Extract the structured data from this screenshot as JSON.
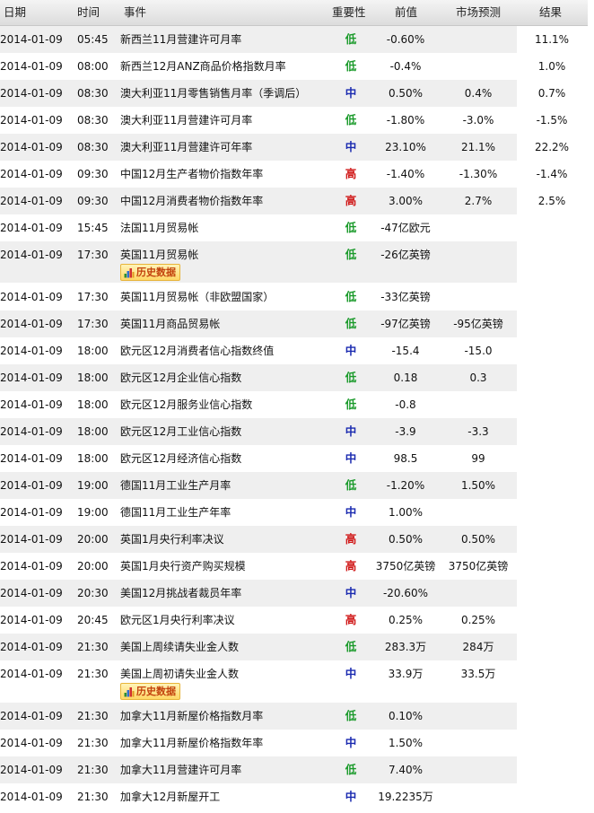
{
  "headers": {
    "date": "日期",
    "time": "时间",
    "event": "事件",
    "importance": "重要性",
    "previous": "前值",
    "forecast": "市场预测",
    "actual": "结果"
  },
  "history_button_label": "历史数据",
  "colors": {
    "low": "#1a9a2a",
    "medium": "#1a2ab0",
    "high": "#d01818",
    "row_alt": "#efefef"
  },
  "rows": [
    {
      "date": "2014-01-09",
      "time": "05:45",
      "event": "新西兰11月营建许可月率",
      "importance": "低",
      "previous": "-0.60%",
      "forecast": "",
      "actual": "11.1%"
    },
    {
      "date": "2014-01-09",
      "time": "08:00",
      "event": "新西兰12月ANZ商品价格指数月率",
      "importance": "低",
      "previous": "-0.4%",
      "forecast": "",
      "actual": "1.0%"
    },
    {
      "date": "2014-01-09",
      "time": "08:30",
      "event": "澳大利亚11月零售销售月率（季调后）",
      "importance": "中",
      "previous": "0.50%",
      "forecast": "0.4%",
      "actual": "0.7%"
    },
    {
      "date": "2014-01-09",
      "time": "08:30",
      "event": "澳大利亚11月营建许可月率",
      "importance": "低",
      "previous": "-1.80%",
      "forecast": "-3.0%",
      "actual": "-1.5%"
    },
    {
      "date": "2014-01-09",
      "time": "08:30",
      "event": "澳大利亚11月营建许可年率",
      "importance": "中",
      "previous": "23.10%",
      "forecast": "21.1%",
      "actual": "22.2%"
    },
    {
      "date": "2014-01-09",
      "time": "09:30",
      "event": "中国12月生产者物价指数年率",
      "importance": "高",
      "previous": "-1.40%",
      "forecast": "-1.30%",
      "actual": "-1.4%"
    },
    {
      "date": "2014-01-09",
      "time": "09:30",
      "event": "中国12月消费者物价指数年率",
      "importance": "高",
      "previous": "3.00%",
      "forecast": "2.7%",
      "actual": "2.5%"
    },
    {
      "date": "2014-01-09",
      "time": "15:45",
      "event": "法国11月贸易帐",
      "importance": "低",
      "previous": "-47亿欧元",
      "forecast": "",
      "actual": ""
    },
    {
      "date": "2014-01-09",
      "time": "17:30",
      "event": "英国11月贸易帐",
      "importance": "低",
      "previous": "-26亿英镑",
      "forecast": "",
      "actual": "",
      "history": true
    },
    {
      "date": "2014-01-09",
      "time": "17:30",
      "event": "英国11月贸易帐（非欧盟国家）",
      "importance": "低",
      "previous": "-33亿英镑",
      "forecast": "",
      "actual": ""
    },
    {
      "date": "2014-01-09",
      "time": "17:30",
      "event": "英国11月商品贸易帐",
      "importance": "低",
      "previous": "-97亿英镑",
      "forecast": "-95亿英镑",
      "actual": ""
    },
    {
      "date": "2014-01-09",
      "time": "18:00",
      "event": "欧元区12月消费者信心指数终值",
      "importance": "中",
      "previous": "-15.4",
      "forecast": "-15.0",
      "actual": ""
    },
    {
      "date": "2014-01-09",
      "time": "18:00",
      "event": "欧元区12月企业信心指数",
      "importance": "低",
      "previous": "0.18",
      "forecast": "0.3",
      "actual": ""
    },
    {
      "date": "2014-01-09",
      "time": "18:00",
      "event": "欧元区12月服务业信心指数",
      "importance": "低",
      "previous": "-0.8",
      "forecast": "",
      "actual": ""
    },
    {
      "date": "2014-01-09",
      "time": "18:00",
      "event": "欧元区12月工业信心指数",
      "importance": "中",
      "previous": "-3.9",
      "forecast": "-3.3",
      "actual": ""
    },
    {
      "date": "2014-01-09",
      "time": "18:00",
      "event": "欧元区12月经济信心指数",
      "importance": "中",
      "previous": "98.5",
      "forecast": "99",
      "actual": ""
    },
    {
      "date": "2014-01-09",
      "time": "19:00",
      "event": "德国11月工业生产月率",
      "importance": "低",
      "previous": "-1.20%",
      "forecast": "1.50%",
      "actual": ""
    },
    {
      "date": "2014-01-09",
      "time": "19:00",
      "event": "德国11月工业生产年率",
      "importance": "中",
      "previous": "1.00%",
      "forecast": "",
      "actual": ""
    },
    {
      "date": "2014-01-09",
      "time": "20:00",
      "event": "英国1月央行利率决议",
      "importance": "高",
      "previous": "0.50%",
      "forecast": "0.50%",
      "actual": ""
    },
    {
      "date": "2014-01-09",
      "time": "20:00",
      "event": "英国1月央行资产购买规模",
      "importance": "高",
      "previous": "3750亿英镑",
      "forecast": "3750亿英镑",
      "actual": ""
    },
    {
      "date": "2014-01-09",
      "time": "20:30",
      "event": "美国12月挑战者裁员年率",
      "importance": "中",
      "previous": "-20.60%",
      "forecast": "",
      "actual": ""
    },
    {
      "date": "2014-01-09",
      "time": "20:45",
      "event": "欧元区1月央行利率决议",
      "importance": "高",
      "previous": "0.25%",
      "forecast": "0.25%",
      "actual": ""
    },
    {
      "date": "2014-01-09",
      "time": "21:30",
      "event": "美国上周续请失业金人数",
      "importance": "低",
      "previous": "283.3万",
      "forecast": "284万",
      "actual": ""
    },
    {
      "date": "2014-01-09",
      "time": "21:30",
      "event": "美国上周初请失业金人数",
      "importance": "中",
      "previous": "33.9万",
      "forecast": "33.5万",
      "actual": "",
      "history": true
    },
    {
      "date": "2014-01-09",
      "time": "21:30",
      "event": "加拿大11月新屋价格指数月率",
      "importance": "低",
      "previous": "0.10%",
      "forecast": "",
      "actual": ""
    },
    {
      "date": "2014-01-09",
      "time": "21:30",
      "event": "加拿大11月新屋价格指数年率",
      "importance": "中",
      "previous": "1.50%",
      "forecast": "",
      "actual": ""
    },
    {
      "date": "2014-01-09",
      "time": "21:30",
      "event": "加拿大11月营建许可月率",
      "importance": "低",
      "previous": "7.40%",
      "forecast": "",
      "actual": ""
    },
    {
      "date": "2014-01-09",
      "time": "21:30",
      "event": "加拿大12月新屋开工",
      "importance": "中",
      "previous": "19.2235万",
      "forecast": "",
      "actual": ""
    }
  ]
}
